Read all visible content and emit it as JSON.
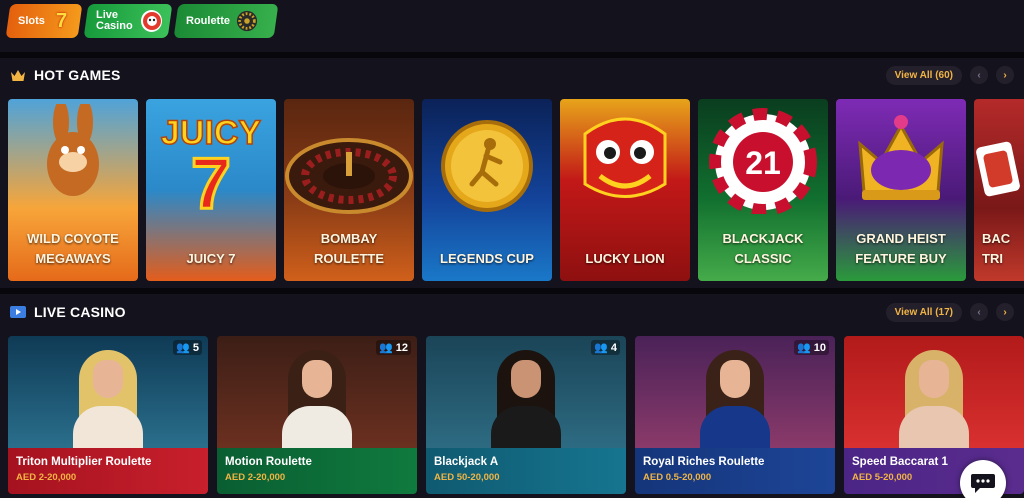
{
  "categories": [
    {
      "label": "Slots",
      "icon": "lucky-seven-icon"
    },
    {
      "label": "Live Casino",
      "icon": "mascot-icon"
    },
    {
      "label": "Roulette",
      "icon": "roulette-wheel-icon"
    }
  ],
  "hot_games": {
    "title": "HOT GAMES",
    "icon": "crown-icon",
    "view_all": "View All (60)",
    "games": [
      {
        "title": "WILD COYOTE MEGAWAYS",
        "colors": [
          "#4fa3d9",
          "#e56a1a"
        ]
      },
      {
        "title": "JUICY 7",
        "colors": [
          "#2b89c9",
          "#e45d1b"
        ]
      },
      {
        "title": "BOMBAY ROULETTE",
        "colors": [
          "#6b2f12",
          "#d0601b"
        ]
      },
      {
        "title": "LEGENDS CUP",
        "colors": [
          "#0c2b6e",
          "#1a60b8"
        ]
      },
      {
        "title": "LUCKY LION",
        "colors": [
          "#9c1515",
          "#e0301d"
        ]
      },
      {
        "title": "BLACKJACK CLASSIC",
        "colors": [
          "#0b5f2c",
          "#37a046"
        ]
      },
      {
        "title": "GRAND HEIST FEATURE BUY",
        "colors": [
          "#4a1a77",
          "#7a2eb4"
        ]
      },
      {
        "title": "BAC TRI",
        "colors": [
          "#8b1d1d",
          "#cc3a2a"
        ]
      }
    ]
  },
  "live_casino": {
    "title": "LIVE CASINO",
    "icon": "play-icon",
    "view_all": "View All (17)",
    "tables": [
      {
        "name": "Triton Multiplier Roulette",
        "bet": "AED 2-20,000",
        "players": "5",
        "colors": [
          "#1d4f6b",
          "#b0202a"
        ]
      },
      {
        "name": "Motion Roulette",
        "bet": "AED 2-20,000",
        "players": "12",
        "colors": [
          "#4a2016",
          "#0c6a3a"
        ]
      },
      {
        "name": "Blackjack A",
        "bet": "AED 50-20,000",
        "players": "4",
        "colors": [
          "#1f4f63",
          "#14607a"
        ]
      },
      {
        "name": "Royal Riches Roulette",
        "bet": "AED 0.5-20,000",
        "players": "10",
        "colors": [
          "#5a2a6a",
          "#1b3f8a"
        ]
      },
      {
        "name": "Speed Baccarat 1",
        "bet": "AED 5-20,000",
        "players": "",
        "colors": [
          "#b31919",
          "#5a2c8e"
        ]
      }
    ]
  },
  "chat": {
    "icon": "chat-bubble-icon"
  }
}
